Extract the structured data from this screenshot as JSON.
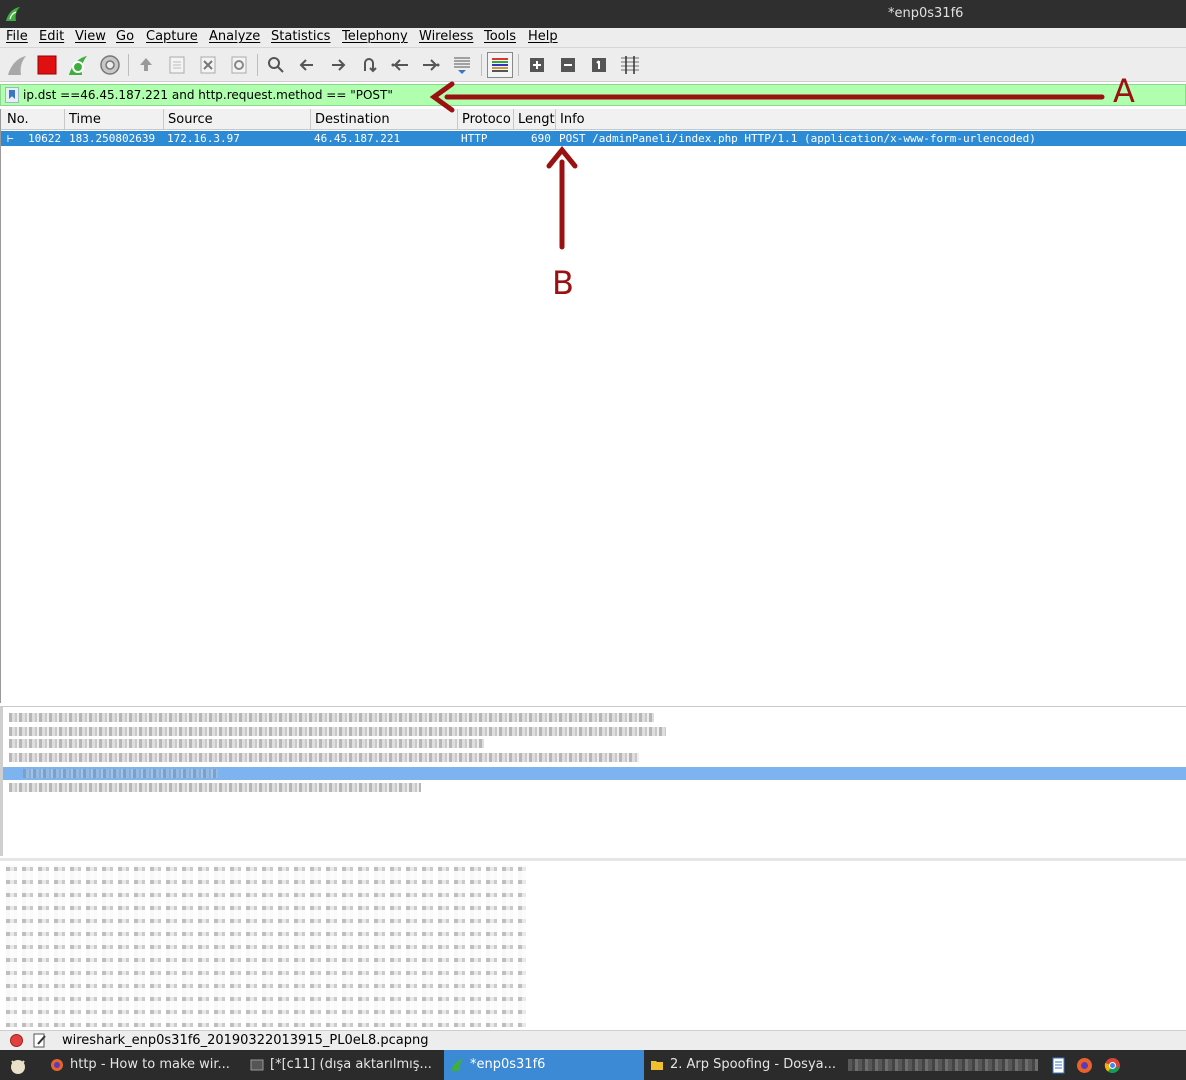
{
  "window": {
    "title": "*enp0s31f6"
  },
  "menu": [
    "File",
    "Edit",
    "View",
    "Go",
    "Capture",
    "Analyze",
    "Statistics",
    "Telephony",
    "Wireless",
    "Tools",
    "Help"
  ],
  "filter": {
    "value": "ip.dst ==46.45.187.221 and http.request.method == \"POST\""
  },
  "packet_list": {
    "columns": [
      "No.",
      "Time",
      "Source",
      "Destination",
      "Protoco",
      "Lengt",
      "Info"
    ],
    "rows": [
      {
        "no": "10622",
        "time": "183.250802639",
        "source": "172.16.3.97",
        "destination": "46.45.187.221",
        "protocol": "HTTP",
        "length": "690",
        "info": "POST /adminPaneli/index.php HTTP/1.1  (application/x-www-form-urlencoded)"
      }
    ]
  },
  "annotations": {
    "a": "A",
    "b": "B"
  },
  "status": {
    "file": "wireshark_enp0s31f6_20190322013915_PL0eL8.pcapng"
  },
  "taskbar": {
    "tasks": [
      "http - How to make wir...",
      "[*[c11] (dışa aktarılmış...",
      "*enp0s31f6",
      "2. Arp Spoofing - Dosya..."
    ]
  },
  "colors": {
    "selection": "#2d8bd6",
    "filter_valid": "#afffaf",
    "annotation": "#9b1010"
  }
}
